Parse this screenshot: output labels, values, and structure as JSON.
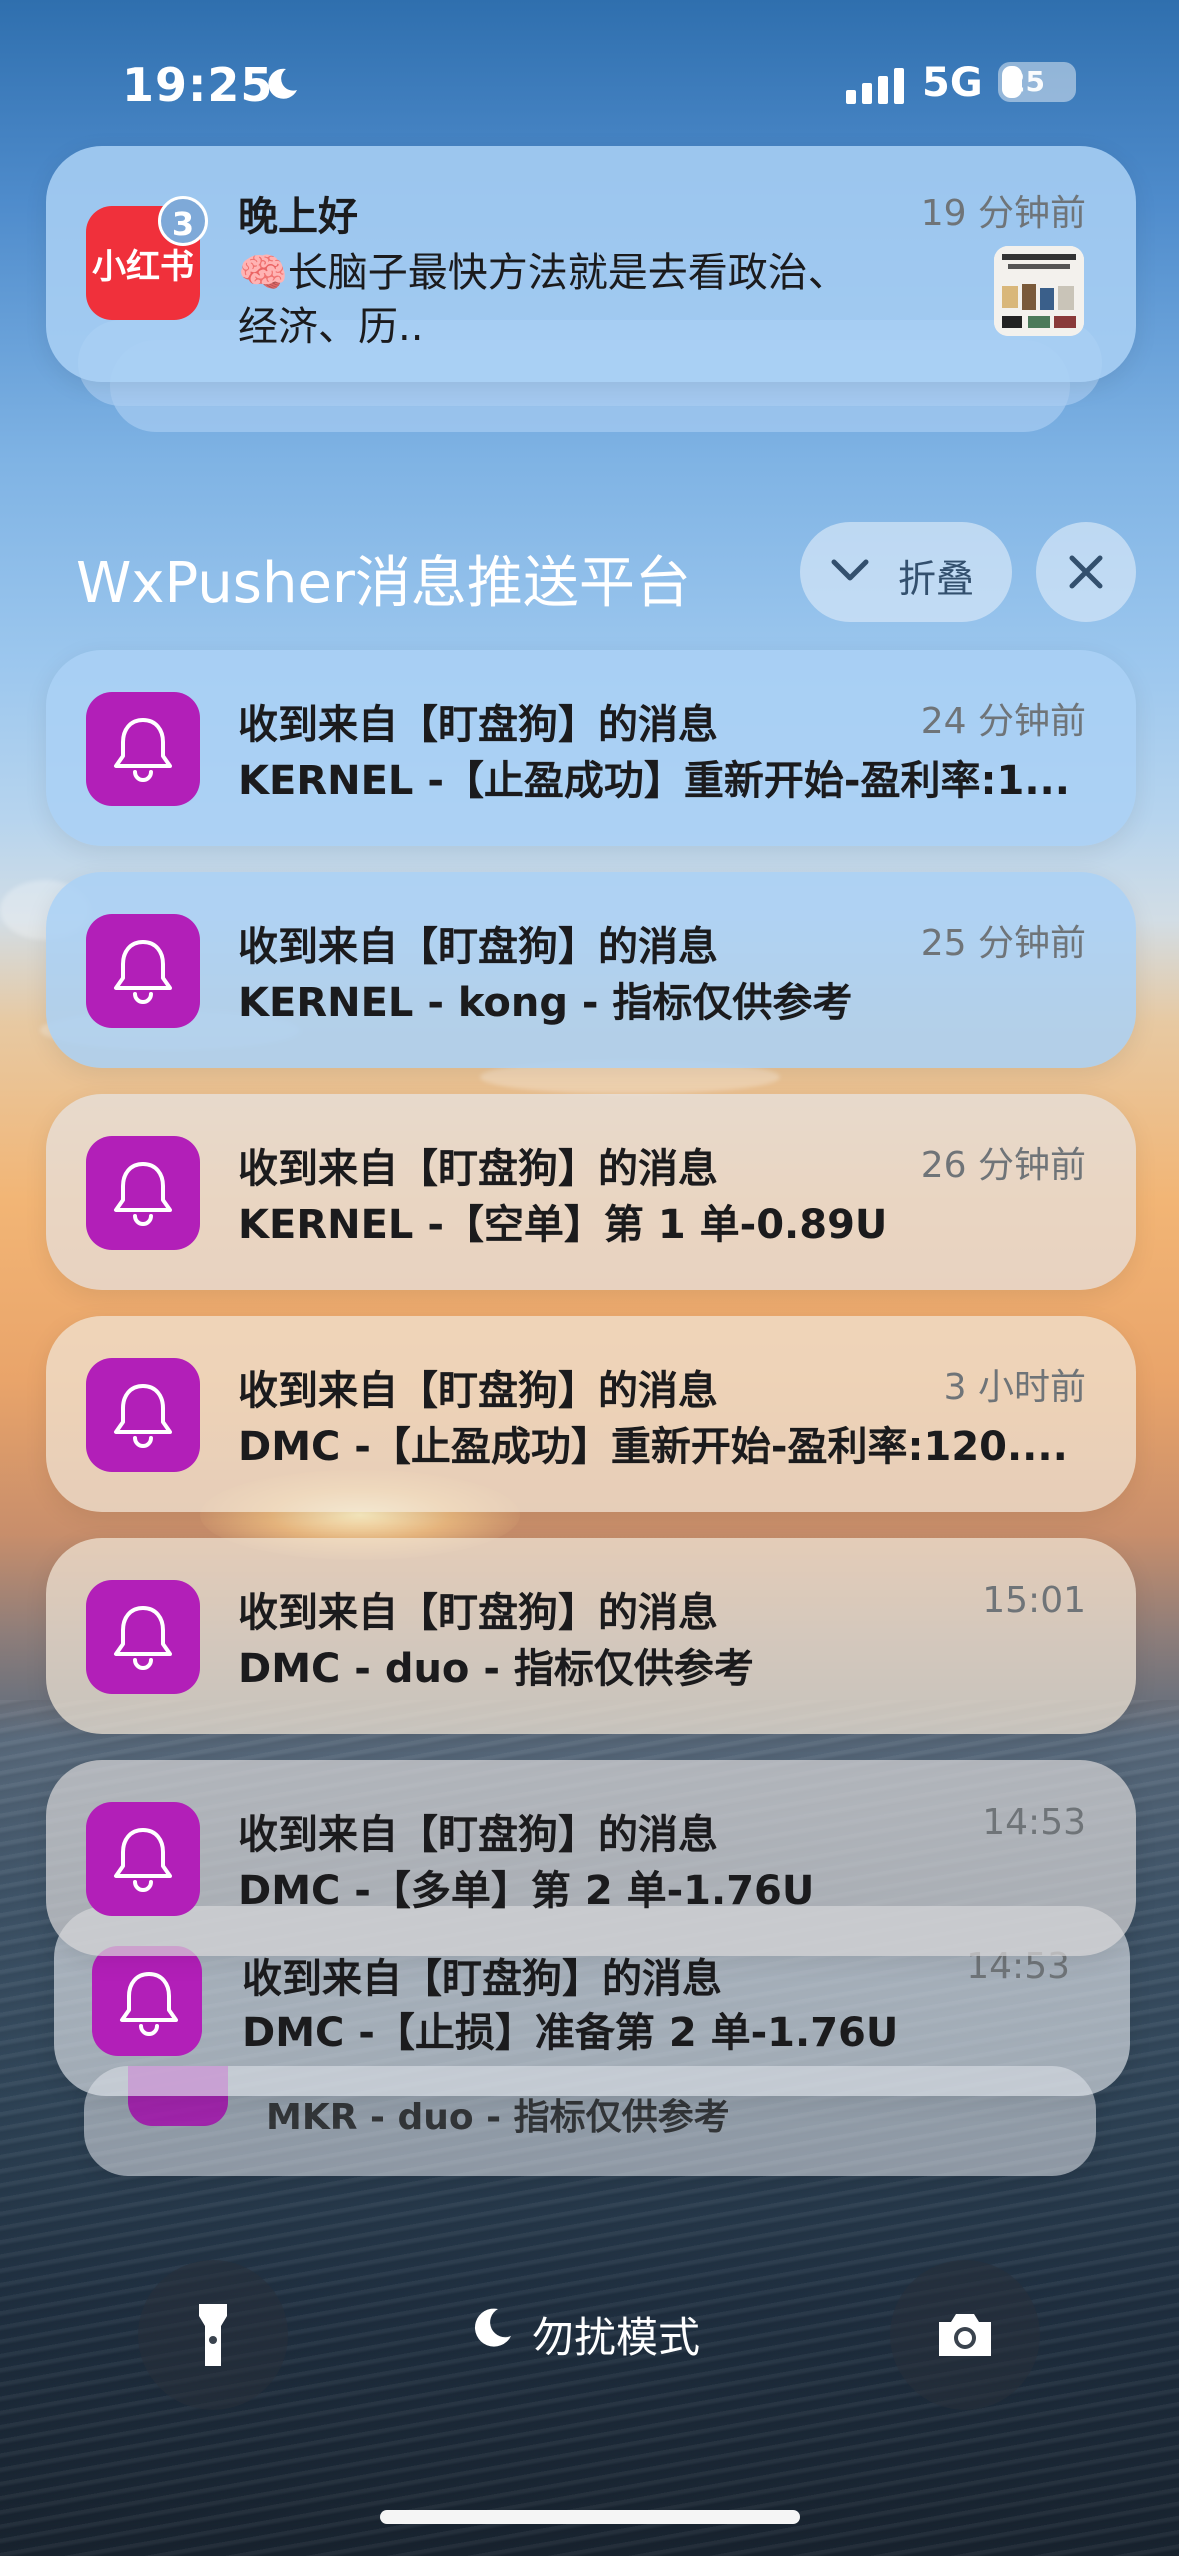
{
  "status_bar": {
    "time": "19:25",
    "network": "5G",
    "battery": "25"
  },
  "pinned_notification": {
    "app_icon_text": "小红书",
    "badge_count": "3",
    "title": "晚上好",
    "body_line1": "🧠长脑子最快方法就是去看政治、",
    "body_line2": "经济、历..",
    "time": "19 分钟前"
  },
  "group": {
    "title": "WxPusher消息推送平台",
    "fold_label": "折叠",
    "notifications": [
      {
        "title": "收到来自【盯盘狗】的消息",
        "body": "KERNEL -【止盈成功】重新开始-盈利率:1...",
        "time": "24 分钟前"
      },
      {
        "title": "收到来自【盯盘狗】的消息",
        "body": "KERNEL - kong - 指标仅供参考",
        "time": "25 分钟前"
      },
      {
        "title": "收到来自【盯盘狗】的消息",
        "body": "KERNEL -【空单】第 1 单-0.89U",
        "time": "26 分钟前"
      },
      {
        "title": "收到来自【盯盘狗】的消息",
        "body": "DMC -【止盈成功】重新开始-盈利率:120....",
        "time": "3 小时前"
      },
      {
        "title": "收到来自【盯盘狗】的消息",
        "body": "DMC - duo - 指标仅供参考",
        "time": "15:01"
      },
      {
        "title": "收到来自【盯盘狗】的消息",
        "body": "DMC -【多单】第 2 单-1.76U",
        "time": "14:53"
      },
      {
        "title": "收到来自【盯盘狗】的消息",
        "body": "DMC -【止损】准备第 2 单-1.76U",
        "time": "14:53"
      },
      {
        "body": "MKR - duo - 指标仅供参考"
      }
    ]
  },
  "bottom": {
    "dnd_label": "勿扰模式"
  },
  "colors": {
    "app_icon_purple": "#b21fb8",
    "xhs_red": "#f0303b"
  }
}
